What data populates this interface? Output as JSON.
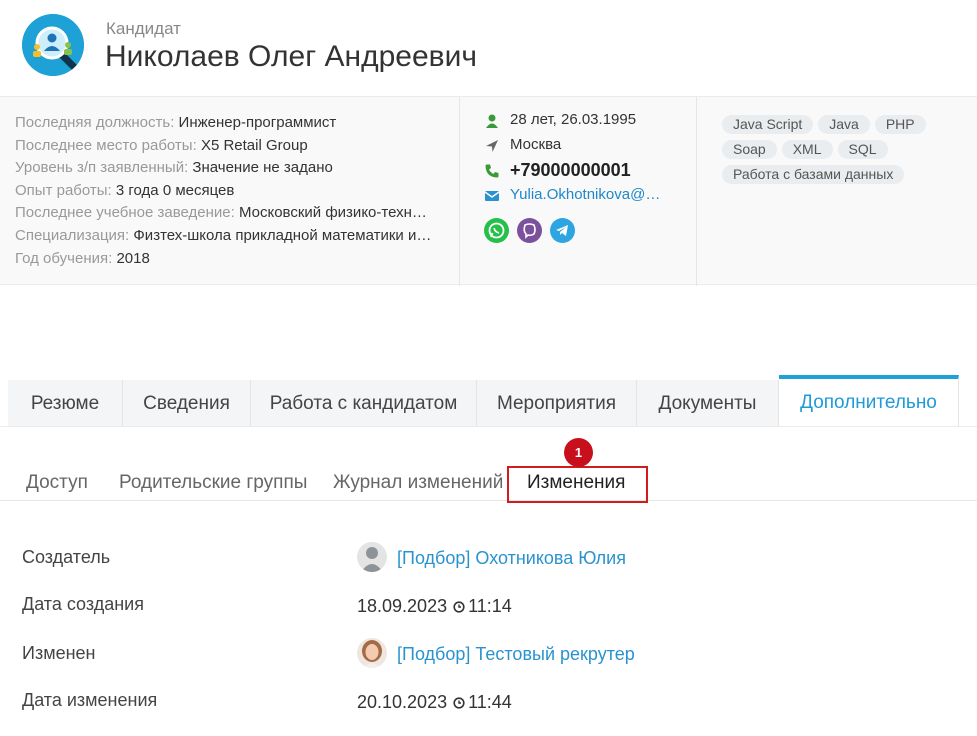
{
  "header": {
    "label": "Кандидат",
    "name": "Николаев Олег Андреевич",
    "logo_icon": "recruiting-search-icon"
  },
  "info": {
    "rows": [
      {
        "key": "Последняя должность:",
        "value": "Инженер-программист"
      },
      {
        "key": "Последнее место работы:",
        "value": "X5 Retail Group"
      },
      {
        "key": "Уровень з/п заявленный:",
        "value": "Значение не задано"
      },
      {
        "key": "Опыт работы:",
        "value": "3 года 0 месяцев"
      },
      {
        "key": "Последнее учебное заведение:",
        "value": "Московский физико-техн…"
      },
      {
        "key": "Специализация:",
        "value": "Физтех-школа прикладной математики и…"
      },
      {
        "key": "Год обучения:",
        "value": "2018"
      }
    ],
    "age": "28 лет, 26.03.1995",
    "city": "Москва",
    "phone": "+79000000001",
    "email": "Yulia.Okhotnikova@mi…",
    "messengers": [
      "whatsapp-icon",
      "viber-icon",
      "telegram-icon"
    ],
    "tags": [
      "Java Script",
      "Java",
      "PHP",
      "Soap",
      "XML",
      "SQL",
      "Работа с базами данных"
    ]
  },
  "tabs": [
    {
      "label": "Резюме"
    },
    {
      "label": "Сведения"
    },
    {
      "label": "Работа с кандидатом"
    },
    {
      "label": "Мероприятия"
    },
    {
      "label": "Документы"
    },
    {
      "label": "Дополнительно",
      "active": true
    }
  ],
  "subtabs": [
    {
      "label": "Доступ"
    },
    {
      "label": "Родительские группы"
    },
    {
      "label": "Журнал изменений"
    },
    {
      "label": "Изменения",
      "active": true
    }
  ],
  "badge": "1",
  "details": {
    "creator_label": "Создатель",
    "creator_value": "[Подбор] Охотникова Юлия",
    "created_label": "Дата создания",
    "created_date": "18.09.2023",
    "created_time": "11:14",
    "modified_label": "Изменен",
    "modified_value": "[Подбор] Тестовый рекрутер",
    "modified_date_label": "Дата изменения",
    "modified_date": "20.10.2023",
    "modified_time": "11:44"
  },
  "colors": {
    "accent": "#1ea0d9",
    "link": "#2a93cf",
    "highlight": "#d21b1b"
  }
}
